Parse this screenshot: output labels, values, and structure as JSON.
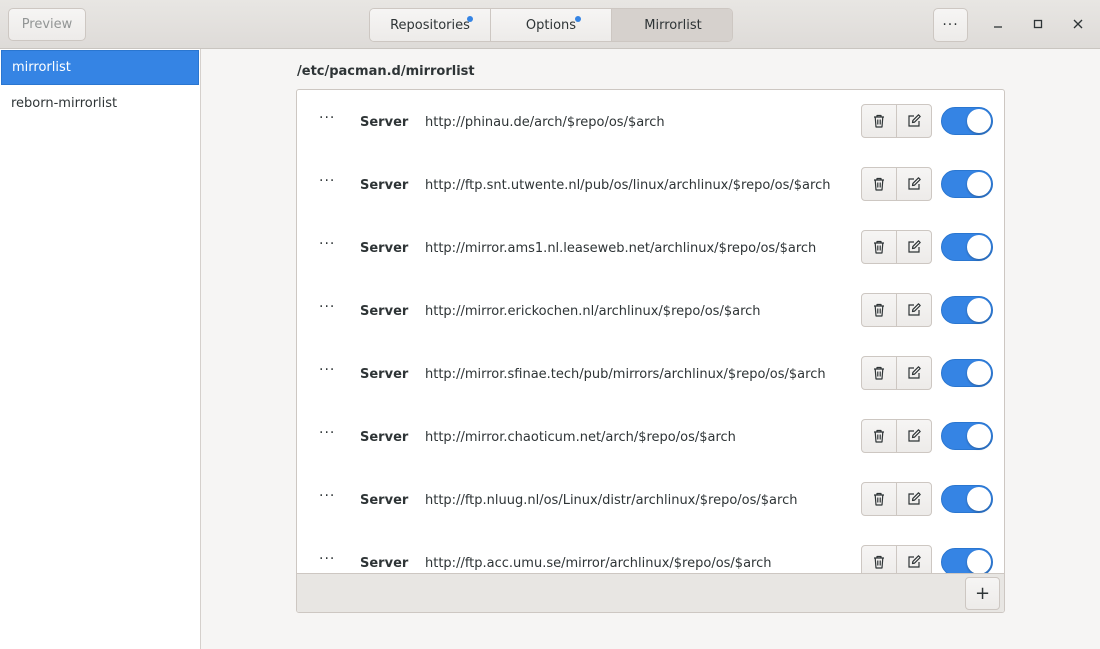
{
  "header": {
    "preview_label": "Preview",
    "tabs": [
      {
        "label": "Repositories",
        "modified": true
      },
      {
        "label": "Options",
        "modified": true
      },
      {
        "label": "Mirrorlist",
        "modified": false,
        "active": true
      }
    ],
    "menu_label": "···",
    "accent_color": "#3584e4"
  },
  "sidebar": {
    "items": [
      {
        "label": "mirrorlist",
        "selected": true
      },
      {
        "label": "reborn-mirrorlist",
        "selected": false
      }
    ]
  },
  "main": {
    "path_title": "/etc/pacman.d/mirrorlist",
    "rows": [
      {
        "handle": "···",
        "key": "Server",
        "value": "http://phinau.de/arch/$repo/os/$arch",
        "enabled": true
      },
      {
        "handle": "···",
        "key": "Server",
        "value": "http://ftp.snt.utwente.nl/pub/os/linux/archlinux/$repo/os/$arch",
        "enabled": true
      },
      {
        "handle": "···",
        "key": "Server",
        "value": "http://mirror.ams1.nl.leaseweb.net/archlinux/$repo/os/$arch",
        "enabled": true
      },
      {
        "handle": "···",
        "key": "Server",
        "value": "http://mirror.erickochen.nl/archlinux/$repo/os/$arch",
        "enabled": true
      },
      {
        "handle": "···",
        "key": "Server",
        "value": "http://mirror.sfinae.tech/pub/mirrors/archlinux/$repo/os/$arch",
        "enabled": true
      },
      {
        "handle": "···",
        "key": "Server",
        "value": "http://mirror.chaoticum.net/arch/$repo/os/$arch",
        "enabled": true
      },
      {
        "handle": "···",
        "key": "Server",
        "value": "http://ftp.nluug.nl/os/Linux/distr/archlinux/$repo/os/$arch",
        "enabled": true
      },
      {
        "handle": "···",
        "key": "Server",
        "value": "http://ftp.acc.umu.se/mirror/archlinux/$repo/os/$arch",
        "enabled": true
      }
    ],
    "add_label": "+"
  }
}
